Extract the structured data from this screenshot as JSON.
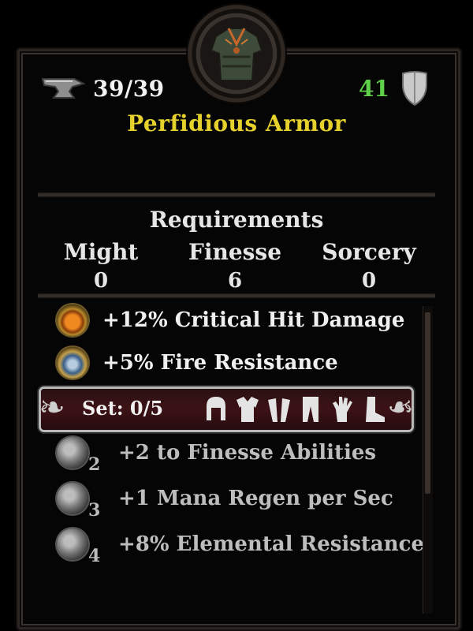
{
  "item": {
    "name": "Perfidious Armor",
    "durability": "39/39",
    "armor_value": "41",
    "icon": "chest-armor-icon"
  },
  "requirements": {
    "title": "Requirements",
    "stats": [
      {
        "label": "Might",
        "value": "0"
      },
      {
        "label": "Finesse",
        "value": "6"
      },
      {
        "label": "Sorcery",
        "value": "0"
      }
    ]
  },
  "bonuses": [
    {
      "text": "+12% Critical Hit Damage",
      "icon": "fire-burst-gem-icon"
    },
    {
      "text": "+5% Fire Resistance",
      "icon": "flame-shield-gem-icon"
    }
  ],
  "set": {
    "label": "Set: 0/5",
    "pieces": [
      "helmet-icon",
      "chest-icon",
      "pauldrons-icon",
      "leggings-icon",
      "gauntlet-icon",
      "boots-icon"
    ]
  },
  "set_bonuses": [
    {
      "count": "2",
      "text": "+2 to Finesse Abilities",
      "icon": "finesse-gem-icon"
    },
    {
      "count": "3",
      "text": "+1 Mana Regen per Sec",
      "icon": "gear-gem-icon"
    },
    {
      "count": "4",
      "text": "+8% Elemental Resistance",
      "icon": "arrow-gem-icon"
    }
  ],
  "colors": {
    "title": "#e6d12c",
    "armor_value": "#5fd04a"
  }
}
